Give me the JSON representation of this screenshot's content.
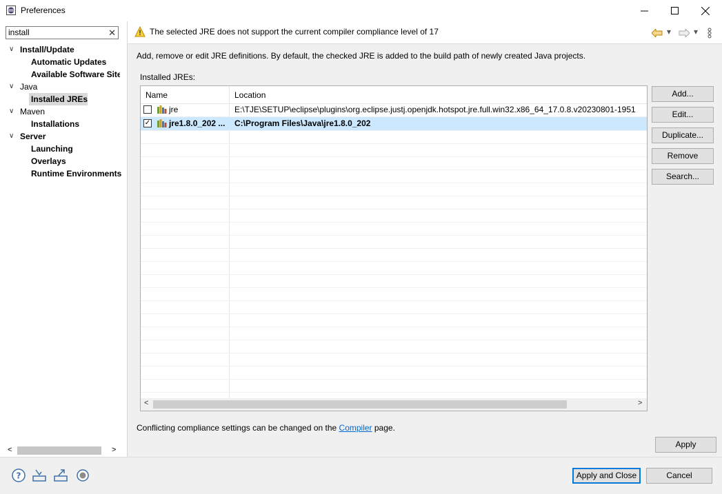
{
  "window": {
    "title": "Preferences",
    "controls": {
      "minimize": "—",
      "maximize": "☐",
      "close": "✕"
    }
  },
  "filter": {
    "value": "install",
    "clear_label": "✕"
  },
  "tree": {
    "items": [
      {
        "label": "Install/Update",
        "bold": true,
        "expanded": true
      },
      {
        "label": "Automatic Updates",
        "bold": true
      },
      {
        "label": "Available Software Site",
        "bold": true
      },
      {
        "label": "Java",
        "bold": false,
        "expanded": true
      },
      {
        "label": "Installed JREs",
        "bold": true,
        "selected": true
      },
      {
        "label": "Maven",
        "bold": false,
        "expanded": true
      },
      {
        "label": "Installations",
        "bold": true
      },
      {
        "label": "Server",
        "bold": true,
        "expanded": true
      },
      {
        "label": "Launching",
        "bold": true
      },
      {
        "label": "Overlays",
        "bold": true
      },
      {
        "label": "Runtime Environments",
        "bold": true
      }
    ]
  },
  "header": {
    "warning": "The selected JRE does not support the current compiler compliance level of 17"
  },
  "page": {
    "description": "Add, remove or edit JRE definitions. By default, the checked JRE is added to the build path of newly created Java projects.",
    "installed_label": "Installed JREs:",
    "columns": {
      "name": "Name",
      "location": "Location"
    },
    "rows": [
      {
        "checked": false,
        "name": "jre",
        "location": "E:\\TJE\\SETUP\\eclipse\\plugins\\org.eclipse.justj.openjdk.hotspot.jre.full.win32.x86_64_17.0.8.v20230801-1951"
      },
      {
        "checked": true,
        "name": "jre1.8.0_202 ...",
        "location": "C:\\Program Files\\Java\\jre1.8.0_202"
      }
    ],
    "buttons": {
      "add": "Add...",
      "edit": "Edit...",
      "duplicate": "Duplicate...",
      "remove": "Remove",
      "search": "Search..."
    },
    "conflict_prefix": "Conflicting compliance settings can be changed on the ",
    "conflict_link": "Compiler",
    "conflict_suffix": " page.",
    "apply": "Apply"
  },
  "footer": {
    "apply_close": "Apply and Close",
    "cancel": "Cancel"
  },
  "colors": {
    "selection": "#cce8ff",
    "link": "#0066cc",
    "accent": "#0078d7",
    "warning": "#f2c200"
  }
}
